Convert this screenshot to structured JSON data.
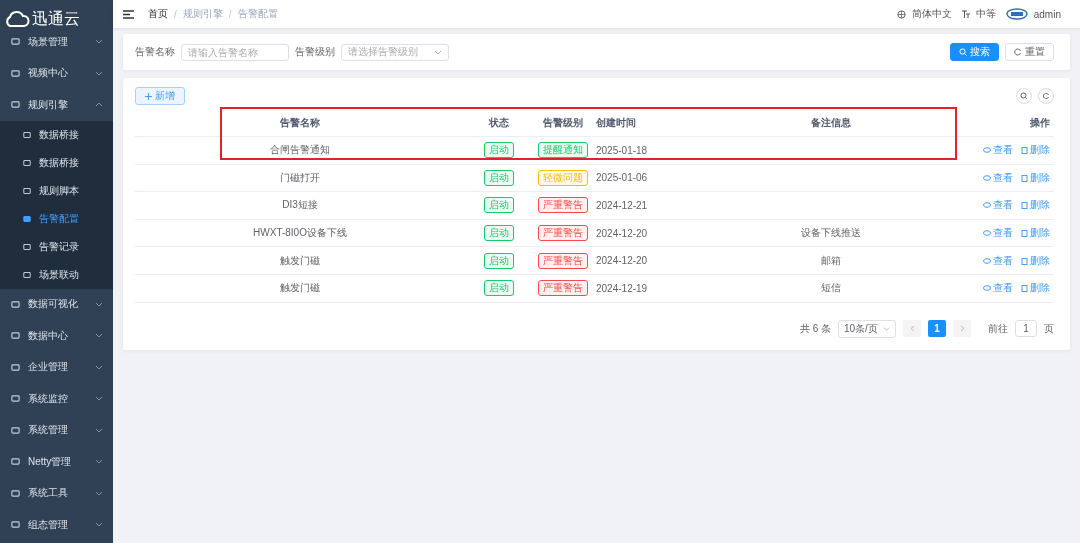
{
  "sidebar": {
    "logo": "迅通云",
    "items": [
      {
        "label": "场景管理",
        "expanded": false
      },
      {
        "label": "视频中心",
        "expanded": false
      },
      {
        "label": "规则引擎",
        "expanded": true,
        "children": [
          {
            "label": "数据桥接",
            "selected": false
          },
          {
            "label": "数据桥接",
            "selected": false
          },
          {
            "label": "规则脚本",
            "selected": false
          },
          {
            "label": "告警配置",
            "selected": true
          },
          {
            "label": "告警记录",
            "selected": false
          },
          {
            "label": "场景联动",
            "selected": false
          }
        ]
      },
      {
        "label": "数据可视化",
        "expanded": false
      },
      {
        "label": "数据中心",
        "expanded": false
      },
      {
        "label": "企业管理",
        "expanded": false
      },
      {
        "label": "系统监控",
        "expanded": false
      },
      {
        "label": "系统管理",
        "expanded": false
      },
      {
        "label": "Netty管理",
        "expanded": false
      },
      {
        "label": "系统工具",
        "expanded": false
      },
      {
        "label": "组态管理",
        "expanded": false
      }
    ]
  },
  "breadcrumb": [
    {
      "label": "首页"
    },
    {
      "separator": "/",
      "label": "规则引擎"
    },
    {
      "separator": "/",
      "label": "告警配置"
    }
  ],
  "header": {
    "language": "简体中文",
    "size": "中等",
    "user": "admin"
  },
  "filters": [
    {
      "label": "告警名称",
      "placeholder": "请输入告警名称",
      "kind": "input"
    },
    {
      "label": "告警级别",
      "placeholder": "请选择告警级别",
      "kind": "select"
    }
  ],
  "filter_buttons": [
    "搜索",
    "重置"
  ],
  "add_button": "新增",
  "table": {
    "columns": [
      "告警名称",
      "状态",
      "告警级别",
      "创建时间",
      "备注信息",
      "操作"
    ],
    "rows": [
      {
        "name": "合闸告警通知",
        "status": "启动",
        "level": "提醒通知",
        "color": "#13ce66",
        "created": "2025-01-18",
        "actions": [
          "查看",
          "删除"
        ]
      },
      {
        "name": "门磁打开",
        "status": "启动",
        "level": "轻微问题",
        "color": "#ffba00",
        "created": "2025-01-06",
        "actions": [
          "查看",
          "删除"
        ]
      },
      {
        "name": "DI3短接",
        "status": "启动",
        "level": "严重警告",
        "color": "#ff4949",
        "created": "2024-12-21",
        "actions": [
          "查看",
          "删除"
        ]
      },
      {
        "name": "HWXT-8I0O设备下线",
        "status": "启动",
        "level": "严重警告",
        "color": "#ff4949",
        "created": "2024-12-20",
        "remark": "设备下线推送",
        "actions": [
          "查看",
          "删除"
        ]
      },
      {
        "name": "触发门磁",
        "status": "启动",
        "level": "严重警告",
        "color": "#ff4949",
        "created": "2024-12-20",
        "remark": "邮箱",
        "actions": [
          "查看",
          "删除"
        ]
      },
      {
        "name": "触发门磁",
        "status": "启动",
        "level": "严重警告",
        "color": "#ff4949",
        "created": "2024-12-19",
        "remark": "短信",
        "actions": [
          "查看",
          "删除"
        ]
      }
    ]
  },
  "pagination": {
    "total": "共 6 条",
    "page_size": "10条/页",
    "pages": [
      {
        "label": "1",
        "selected": true
      }
    ],
    "goto_label": "前往",
    "goto_value": "1",
    "page_unit": "页"
  }
}
